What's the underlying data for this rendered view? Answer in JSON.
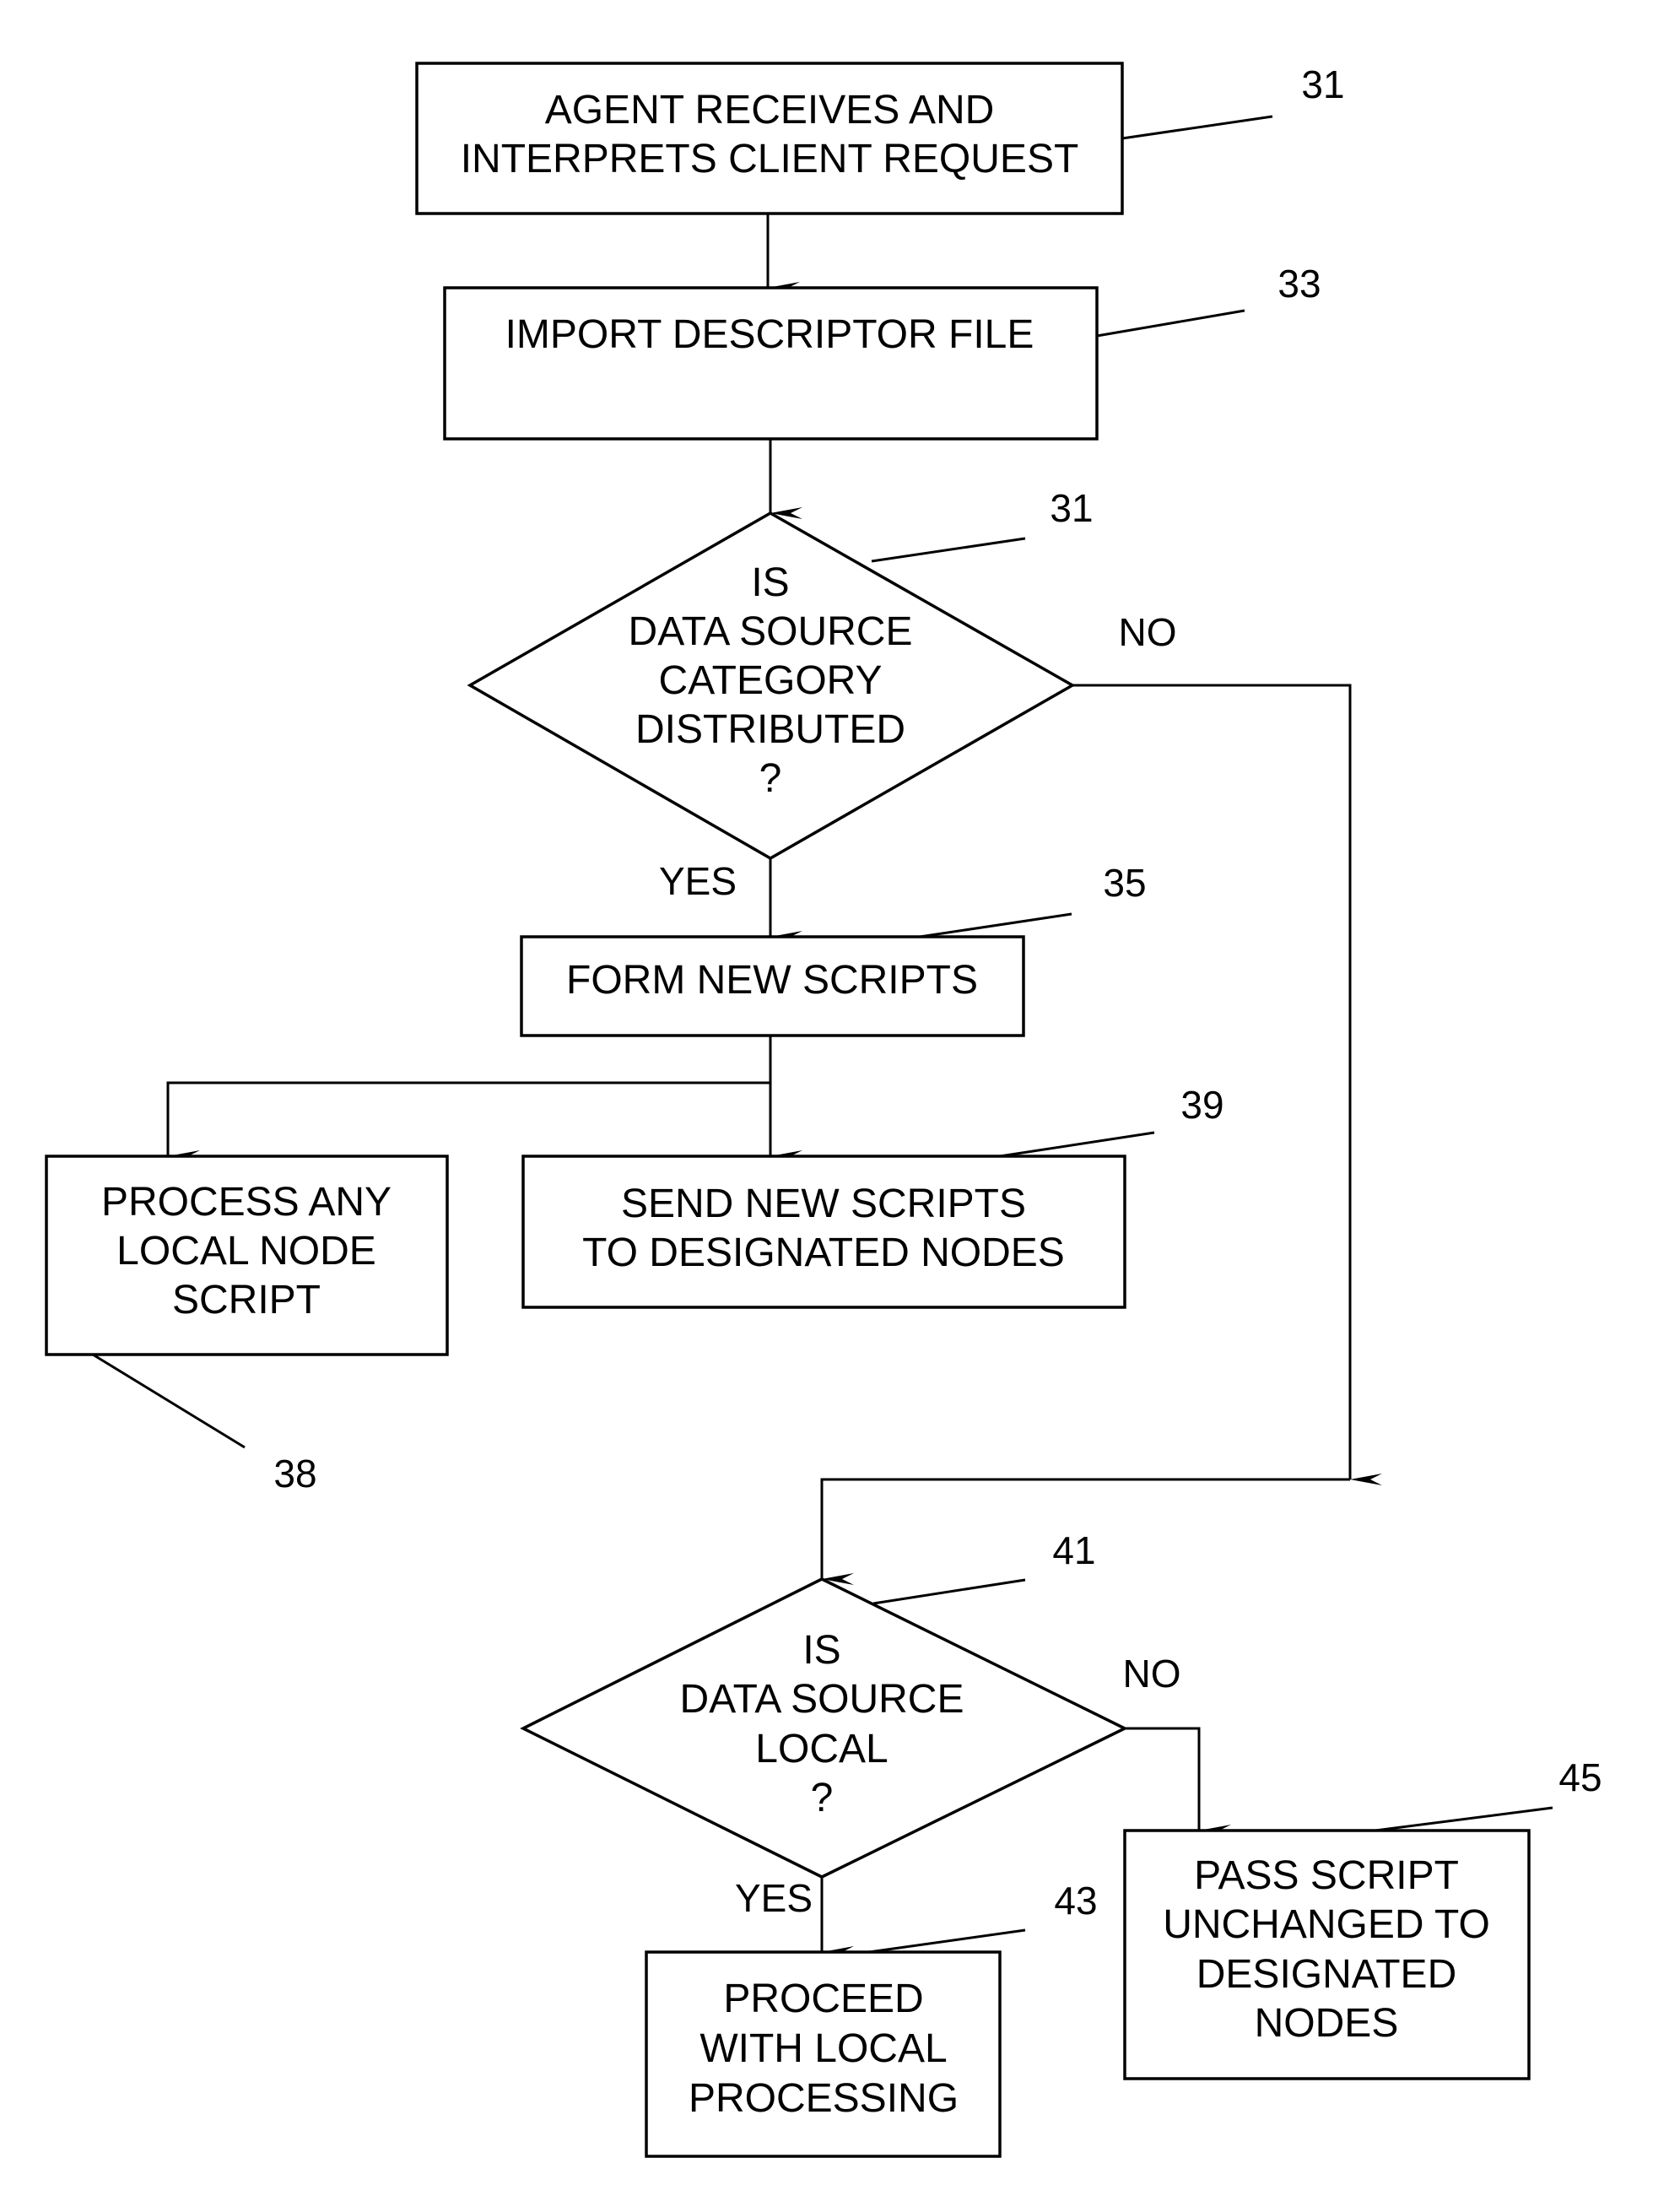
{
  "diagram": {
    "type": "flowchart",
    "nodes": [
      {
        "id": "n31a",
        "shape": "process",
        "ref": "31",
        "lines": [
          "AGENT RECEIVES AND",
          "INTERPRETS CLIENT REQUEST"
        ]
      },
      {
        "id": "n33",
        "shape": "process",
        "ref": "33",
        "lines": [
          "IMPORT DESCRIPTOR FILE"
        ]
      },
      {
        "id": "n31b",
        "shape": "decision",
        "ref": "31",
        "lines": [
          "IS",
          "DATA SOURCE",
          "CATEGORY",
          "DISTRIBUTED",
          "?"
        ]
      },
      {
        "id": "n35",
        "shape": "process",
        "ref": "35",
        "lines": [
          "FORM NEW SCRIPTS"
        ]
      },
      {
        "id": "n38",
        "shape": "process",
        "ref": "38",
        "lines": [
          "PROCESS ANY",
          "LOCAL NODE",
          "SCRIPT"
        ]
      },
      {
        "id": "n39",
        "shape": "process",
        "ref": "39",
        "lines": [
          "SEND NEW SCRIPTS",
          "TO DESIGNATED NODES"
        ]
      },
      {
        "id": "n41",
        "shape": "decision",
        "ref": "41",
        "lines": [
          "IS",
          "DATA SOURCE",
          "LOCAL",
          "?"
        ]
      },
      {
        "id": "n43",
        "shape": "process",
        "ref": "43",
        "lines": [
          "PROCEED",
          "WITH LOCAL",
          "PROCESSING"
        ]
      },
      {
        "id": "n45",
        "shape": "process",
        "ref": "45",
        "lines": [
          "PASS SCRIPT",
          "UNCHANGED TO",
          "DESIGNATED",
          "NODES"
        ]
      }
    ],
    "edges": [
      {
        "from": "n31a",
        "to": "n33",
        "label": ""
      },
      {
        "from": "n33",
        "to": "n31b",
        "label": ""
      },
      {
        "from": "n31b",
        "to": "n35",
        "label": "YES"
      },
      {
        "from": "n31b",
        "to": "n41",
        "label": "NO"
      },
      {
        "from": "n35",
        "to": "n38",
        "label": ""
      },
      {
        "from": "n35",
        "to": "n39",
        "label": ""
      },
      {
        "from": "n41",
        "to": "n43",
        "label": "YES"
      },
      {
        "from": "n41",
        "to": "n45",
        "label": "NO"
      }
    ]
  },
  "labels": {
    "decision1_yes": "YES",
    "decision1_no": "NO",
    "decision2_yes": "YES",
    "decision2_no": "NO"
  }
}
